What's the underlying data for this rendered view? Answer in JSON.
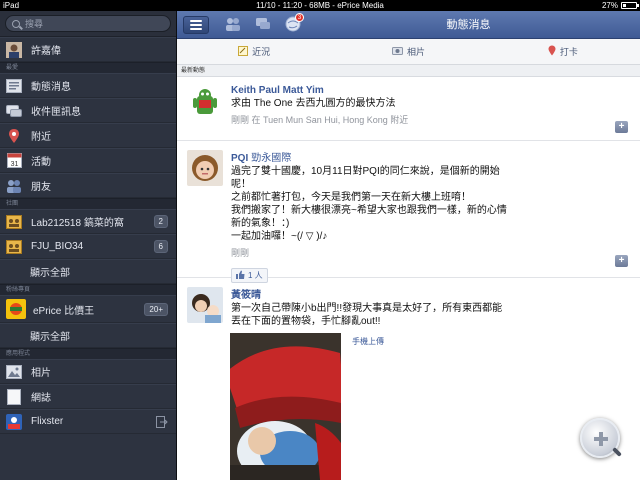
{
  "status_bar": {
    "device": "iPad",
    "center": "11/10 - 11:20 - 68MB - ePrice Media",
    "battery": "27%"
  },
  "sidebar": {
    "search_placeholder": "搜尋",
    "profile": {
      "name": "許嘉偉"
    },
    "sections": {
      "favorites": "最愛",
      "groups": "社團",
      "pages": "粉絲專頁",
      "apps": "應用程式"
    },
    "favorites": [
      {
        "label": "動態消息",
        "icon": "news-feed-icon"
      },
      {
        "label": "收件匣訊息",
        "icon": "inbox-icon"
      },
      {
        "label": "附近",
        "icon": "nearby-pin-icon"
      },
      {
        "label": "活動",
        "icon": "calendar-icon"
      },
      {
        "label": "朋友",
        "icon": "friends-icon"
      }
    ],
    "groups": [
      {
        "label": "Lab212518 鎬菜的窩",
        "badge": "2"
      },
      {
        "label": "FJU_BIO34",
        "badge": "6"
      }
    ],
    "groups_show_all": "顯示全部",
    "pages": [
      {
        "label": "ePrice 比價王",
        "badge": "20+"
      }
    ],
    "pages_show_all": "顯示全部",
    "apps": [
      {
        "label": "相片",
        "icon": "photos-icon"
      },
      {
        "label": "網誌",
        "icon": "notes-icon"
      },
      {
        "label": "Flixster",
        "icon": "flixster-icon"
      }
    ]
  },
  "header": {
    "title": "動態消息",
    "notification_count": "3"
  },
  "actions": {
    "status": "近況",
    "photo": "相片",
    "checkin": "打卡"
  },
  "sort_label": "最新動態",
  "stories": [
    {
      "name": "Keith Paul Matt Yim",
      "message": "求由 The One 去西九圓方的最快方法",
      "meta": "剛剛 在 Tuen Mun San Hui, Hong Kong 附近"
    },
    {
      "name": "PQI",
      "name_extra": "勁永國際",
      "lines": [
        "過完了雙十國慶，10月11日對PQI的同仁來說，是個新的開始",
        "呢！",
        "之前都忙著打包，今天是我們第一天在新大樓上班唷！",
        "我們搬家了！新大樓很漂亮~希望大家也跟我們一樣，新的心情",
        "新的氣象！：)",
        "一起加油囉！~(/ ▽ )/♪"
      ],
      "meta": "剛剛",
      "likes": "1 人"
    },
    {
      "name": "黃筱晴",
      "lines": [
        "第一次自己帶陳小b出門!!發現大事真是太好了，所有東西都能",
        "丟在下面的置物袋，手忙腳亂out!!"
      ],
      "upload_source": "手機上傳"
    }
  ]
}
